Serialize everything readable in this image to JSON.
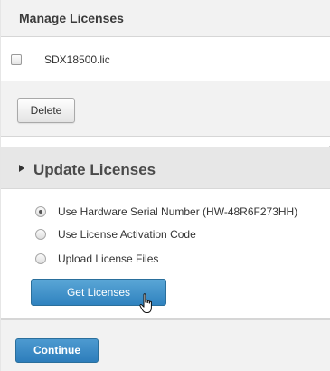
{
  "manage": {
    "title": "Manage Licenses",
    "licenses": [
      {
        "name": "SDX18500.lic",
        "checked": false
      }
    ],
    "delete_label": "Delete"
  },
  "update": {
    "title": "Update Licenses",
    "expanded_icon": "triangle-right-icon",
    "options": [
      {
        "label": "Use Hardware Serial Number (HW-48R6F273HH)",
        "checked": true
      },
      {
        "label": "Use License Activation Code",
        "checked": false
      },
      {
        "label": "Upload License Files",
        "checked": false
      }
    ],
    "get_licenses_label": "Get Licenses"
  },
  "footer": {
    "continue_label": "Continue"
  },
  "colors": {
    "primary_button": "#2f82bf",
    "section_header_bg": "#e7e7e7",
    "panel_bg": "#f2f2f2"
  }
}
